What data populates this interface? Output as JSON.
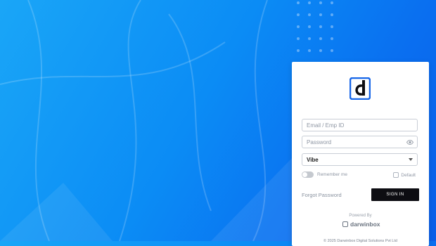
{
  "login": {
    "email_placeholder": "Email / Emp ID",
    "password_placeholder": "Password",
    "workspace_selected": "Vibe",
    "remember_label": "Remember me",
    "theme_label": "Default",
    "forgot_label": "Forgot Password",
    "signin_label": "SIGN IN",
    "powered_label": "Powered By",
    "brand_name": "darwinbox",
    "copyright": "© 2025 Darwinbox Digital Solutions Pvt Ltd"
  },
  "colors": {
    "background_start": "#1aa6f7",
    "background_end": "#0b5ee8",
    "logo_blue": "#1565e8",
    "button_dark": "#0d0d12"
  },
  "icons": [
    "darwinbox-logo-icon",
    "eye-icon",
    "chevron-down-icon",
    "theme-icon",
    "darwinbox-brand-icon"
  ]
}
